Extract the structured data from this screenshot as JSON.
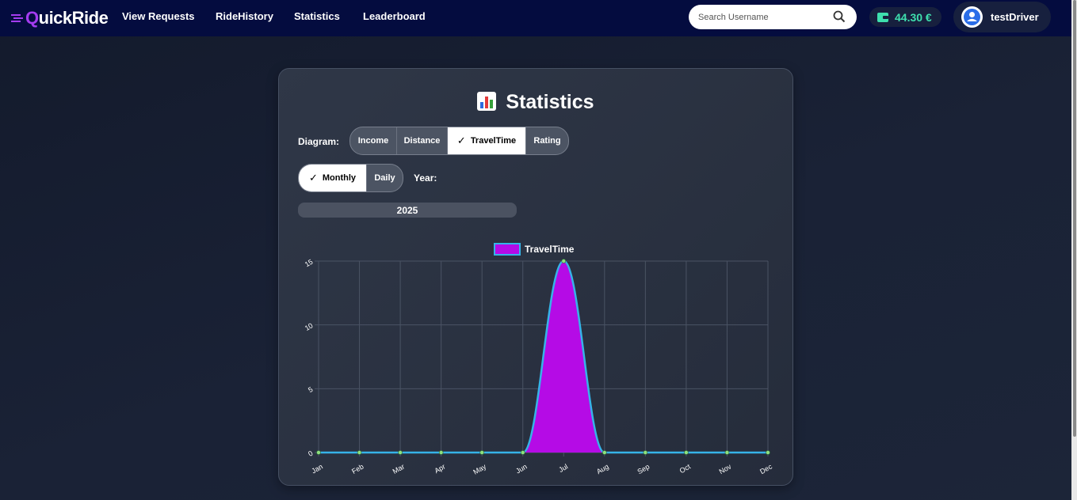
{
  "nav": {
    "logo_q": "Q",
    "logo_rest": "uickRide",
    "links": [
      "View Requests",
      "RideHistory",
      "Statistics",
      "Leaderboard"
    ],
    "search_placeholder": "Search Username",
    "wallet": "44.30 €",
    "username": "testDriver"
  },
  "page": {
    "title": "Statistics",
    "diagram_label": "Diagram:",
    "diagram_options": [
      "Income",
      "Distance",
      "TravelTime",
      "Rating"
    ],
    "diagram_selected": "TravelTime",
    "period_options": [
      "Monthly",
      "Daily"
    ],
    "period_selected": "Monthly",
    "year_label": "Year:",
    "year": "2025"
  },
  "colors": {
    "accent": "#a43cf0",
    "fill": "#b50be6",
    "line": "#36b3e8",
    "point": "#8fe07e",
    "wallet": "#3ee0ae"
  },
  "chart_data": {
    "type": "area",
    "categories": [
      "Jan",
      "Feb",
      "Mar",
      "Apr",
      "May",
      "Jun",
      "Jul",
      "Aug",
      "Sep",
      "Oct",
      "Nov",
      "Dec"
    ],
    "series": [
      {
        "name": "TravelTime",
        "values": [
          0,
          0,
          0,
          0,
          0,
          0,
          15,
          0,
          0,
          0,
          0,
          0
        ]
      }
    ],
    "ylim": [
      0,
      15
    ],
    "yticks": [
      0,
      5,
      10,
      15
    ],
    "grid": true,
    "legend": "top"
  }
}
